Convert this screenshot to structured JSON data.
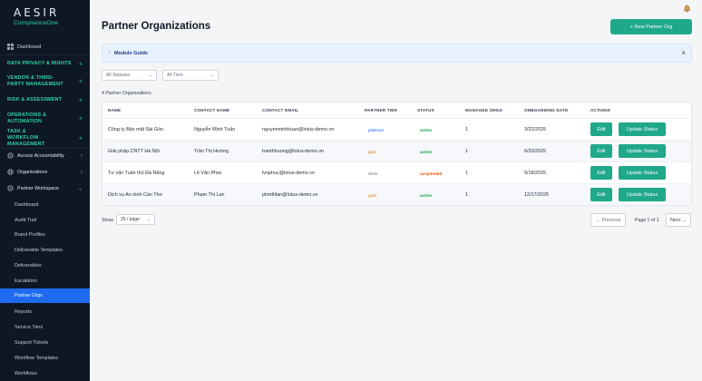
{
  "app": {
    "logo_text": "AESIR",
    "logo_sub": "ComplianceOne"
  },
  "sidebar": {
    "dashboard": "Dashboard",
    "sections": [
      {
        "label": "DATA PRIVACY & RIGHTS"
      },
      {
        "label": "VENDOR & THIRD-PARTY MANAGEMENT"
      },
      {
        "label": "RISK & ASSESSMENT"
      },
      {
        "label": "OPERATIONS & AUTOMATION"
      },
      {
        "label": "TASK & WORKFLOW MANAGEMENT"
      }
    ],
    "groups": [
      {
        "label": "Access Accountability"
      },
      {
        "label": "Organizations"
      },
      {
        "label": "Partner Workspace"
      }
    ],
    "sub_items": [
      {
        "label": "Dashboard"
      },
      {
        "label": "Audit Trail"
      },
      {
        "label": "Brand Profiles"
      },
      {
        "label": "Deliverable Templates"
      },
      {
        "label": "Deliverables"
      },
      {
        "label": "Escalation"
      },
      {
        "label": "Partner Orgs"
      },
      {
        "label": "Reports"
      },
      {
        "label": "Service Tiers"
      },
      {
        "label": "Support Tickets"
      },
      {
        "label": "Workflow Templates"
      },
      {
        "label": "Workflows"
      }
    ],
    "active_item": "Partner Orgs"
  },
  "header": {
    "title": "Partner Organizations",
    "new_button": "+ New Partner Org"
  },
  "guide": {
    "caret": "›",
    "label": "Module Guide",
    "close": "×"
  },
  "filters": {
    "status": "All Statuses",
    "tier": "All Tiers"
  },
  "count_text": "4 Partner Organizations",
  "table": {
    "columns": [
      "NAME",
      "CONTACT NAME",
      "CONTACT EMAIL",
      "PARTNER TIER",
      "STATUS",
      "MANAGED ORGS",
      "ONBOARDING DATE",
      "ACTIONS"
    ],
    "rows": [
      {
        "name": "Công ty Bảo mật Sài Gòn",
        "contact": "Nguyễn Minh Tuấn",
        "email": "nguyenminhtuan@lotus-demo.vn",
        "tier": "platinum",
        "status": "active",
        "managed": "1",
        "date": "3/22/2025",
        "edit": "Edit",
        "update": "Update Status"
      },
      {
        "name": "Giải pháp CNTT Hà Nội",
        "contact": "Trần Thị Hương",
        "email": "tranthhuong@lotus-demo.vn",
        "tier": "gold",
        "status": "active",
        "managed": "1",
        "date": "6/20/2025",
        "edit": "Edit",
        "update": "Update Status"
      },
      {
        "name": "Tư vấn Tuân thủ Đà Nẵng",
        "contact": "Lê Văn Phúc",
        "email": "lvnphuc@lotus-demo.vn",
        "tier": "silver",
        "status": "suspended",
        "managed": "1",
        "date": "9/18/2025",
        "edit": "Edit",
        "update": "Update Status"
      },
      {
        "name": "Dịch vụ An ninh Cần Thơ",
        "contact": "Phạm Thị Lan",
        "email": "phmthlan@lotus-demo.vn",
        "tier": "gold",
        "status": "active",
        "managed": "1",
        "date": "12/17/2025",
        "edit": "Edit",
        "update": "Update Status"
      }
    ]
  },
  "pagination": {
    "show_label": "Show",
    "per_page": "25 / page",
    "previous": "← Previous",
    "page_info": "Page 1 of 1",
    "next": "Next →"
  },
  "colors": {
    "accent": "#1fa88a",
    "sidebar_bg": "#0e1726",
    "active": "#1e6bf0",
    "tier_platinum": "#2563eb",
    "tier_gold": "#d97706",
    "tier_silver": "#6b7280",
    "status_active": "#16a34a",
    "status_suspended": "#ea580c"
  }
}
